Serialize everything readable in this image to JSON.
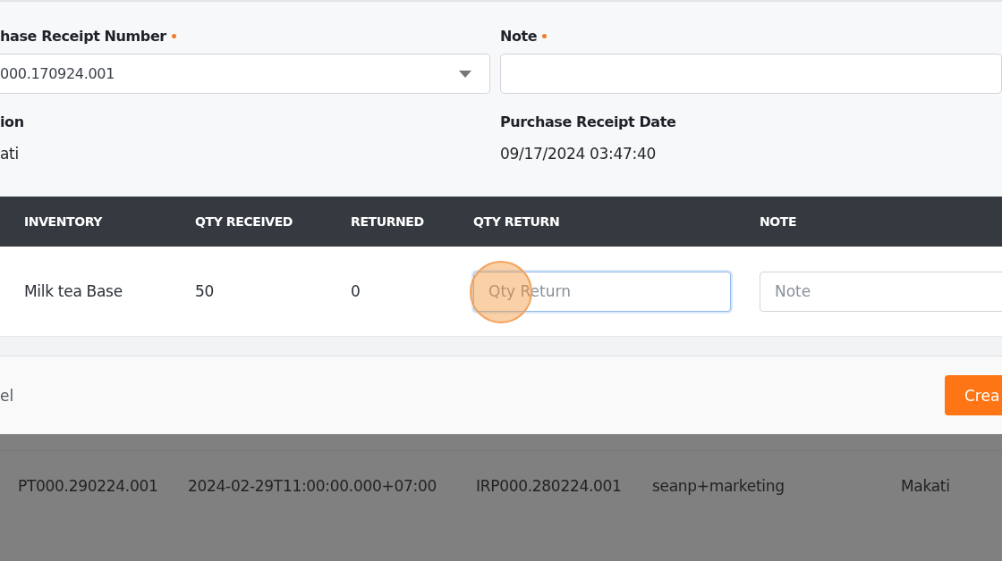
{
  "form": {
    "fields": [
      {
        "label": "hase Receipt Number",
        "required": true,
        "kind": "select",
        "value": "000.170924.001"
      },
      {
        "label": "Note",
        "required": true,
        "kind": "text"
      }
    ],
    "info": [
      {
        "label": "ion",
        "value": "ati"
      },
      {
        "label": "Purchase Receipt Date",
        "value": "09/17/2024 03:47:40"
      }
    ]
  },
  "table": {
    "columns": [
      "INVENTORY",
      "QTY RECEIVED",
      "RETURNED",
      "QTY RETURN",
      "NOTE"
    ],
    "rows": [
      {
        "inventory": "Milk tea Base",
        "qty_received": "50",
        "returned": "0",
        "qty_return_placeholder": "Qty Return",
        "qty_return_focused": true,
        "note_placeholder": "Note"
      }
    ]
  },
  "footer": {
    "cancel": "el",
    "create": "Crea"
  },
  "background_table": {
    "rows": [
      [
        "PT000.290224.001",
        "2024-02-29T11:00:00.000+07:00",
        "IRP000.280224.001",
        "seanp+marketing",
        "Makati"
      ]
    ]
  }
}
